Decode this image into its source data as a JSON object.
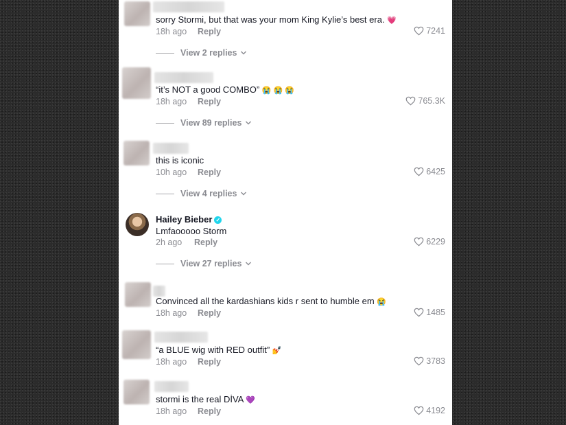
{
  "reply_label": "Reply",
  "comments": [
    {
      "text": "sorry Stormi, but that was your mom King Kylie’s best era.",
      "emoji": "💗",
      "time": "18h ago",
      "likes": "7241",
      "view_replies": "View 2 replies"
    },
    {
      "text": "“it’s NOT a good COMBO”",
      "emoji": "😭 😭 😭",
      "time": "18h ago",
      "likes": "765.3K",
      "view_replies": "View 89 replies"
    },
    {
      "text": "this is iconic",
      "emoji": "",
      "time": "10h ago",
      "likes": "6425",
      "view_replies": "View 4 replies"
    },
    {
      "name": "Hailey Bieber",
      "verified": true,
      "text": "Lmfaooooo Storm",
      "emoji": "",
      "time": "2h ago",
      "likes": "6229",
      "view_replies": "View 27 replies"
    },
    {
      "text": "Convinced all the kardashians kids r sent to humble em",
      "emoji": "😭",
      "time": "18h ago",
      "likes": "1485"
    },
    {
      "text": "“a BLUE wig with RED outfit”",
      "emoji": "💅",
      "time": "18h ago",
      "likes": "3783"
    },
    {
      "text": "stormi is the real DİVA",
      "emoji": "💜",
      "time": "18h ago",
      "likes": "4192"
    }
  ],
  "icons": {
    "like": "heart-outline-icon",
    "expand": "chevron-down-icon",
    "verified": "verified-badge-icon"
  },
  "colors": {
    "verified": "#20d5ec",
    "secondary_text": "#8a8b91"
  }
}
